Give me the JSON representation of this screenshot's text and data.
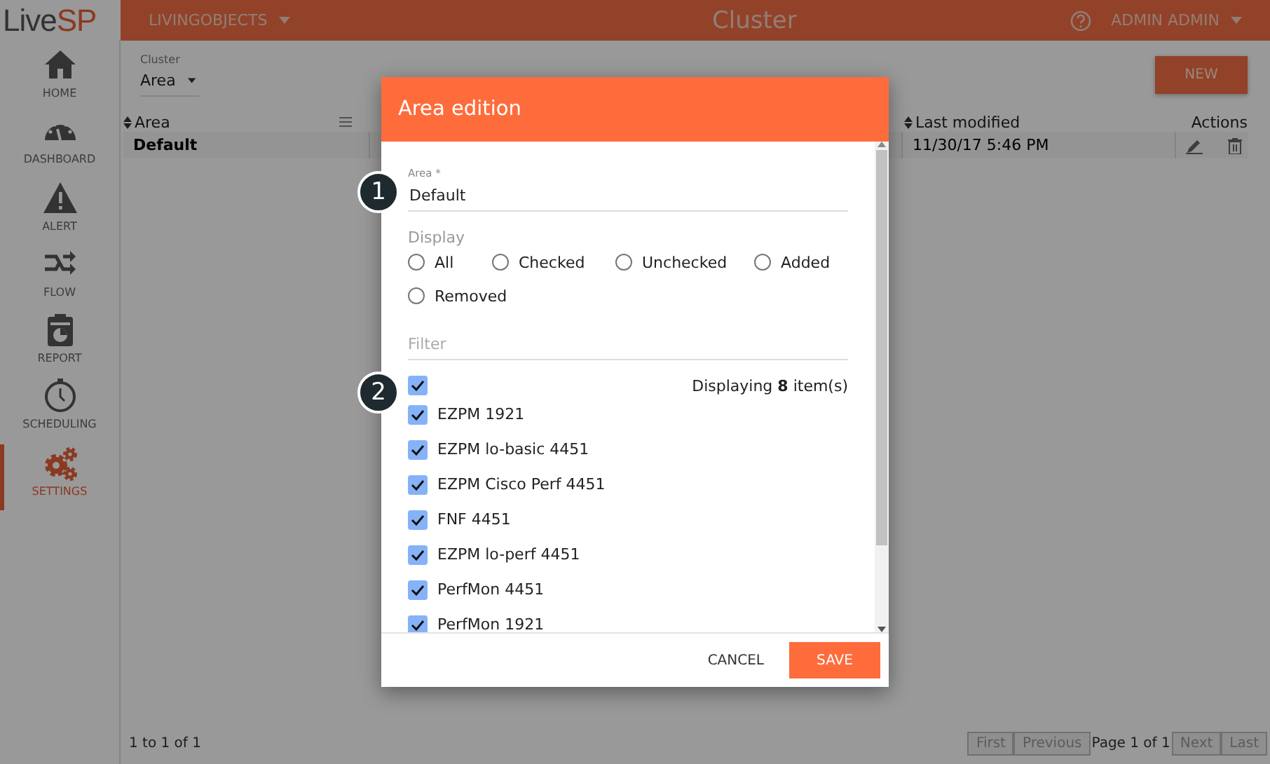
{
  "header": {
    "logo": [
      "Live",
      "SP"
    ],
    "org": "LIVINGOBJECTS",
    "title": "Cluster",
    "user": "ADMIN ADMIN"
  },
  "sidebar": {
    "items": [
      {
        "kind": "home",
        "label": "HOME",
        "selected": false
      },
      {
        "kind": "dashboard",
        "label": "DASHBOARD",
        "selected": false
      },
      {
        "kind": "alert",
        "label": "ALERT",
        "selected": false
      },
      {
        "kind": "flow",
        "label": "FLOW",
        "selected": false
      },
      {
        "kind": "report",
        "label": "REPORT",
        "selected": false
      },
      {
        "kind": "scheduling",
        "label": "SCHEDULING",
        "selected": false
      },
      {
        "kind": "settings",
        "label": "SETTINGS",
        "selected": true
      }
    ]
  },
  "toolbar": {
    "cluster_label": "Cluster",
    "cluster_value": "Area",
    "new_button": "NEW"
  },
  "table": {
    "columns": [
      "Area",
      "Last modified",
      "Actions"
    ],
    "rows": [
      {
        "area": "Default",
        "last_modified": "11/30/17 5:46 PM"
      }
    ]
  },
  "footer": {
    "count": "1 to 1 of 1",
    "pager": [
      {
        "label": "First",
        "disabled": true
      },
      {
        "label": "Previous",
        "disabled": true
      }
    ],
    "page": "Page 1 of 1",
    "pager_after": [
      {
        "label": "Next",
        "disabled": true
      },
      {
        "label": "Last",
        "disabled": true
      }
    ]
  },
  "dialog": {
    "title": "Area edition",
    "area_label": "Area *",
    "area_value": "Default",
    "display_label": "Display",
    "options": [
      {
        "label": "All",
        "selected": false
      },
      {
        "label": "Checked",
        "selected": false
      },
      {
        "label": "Unchecked",
        "selected": false
      },
      {
        "label": "Added",
        "selected": false
      },
      {
        "label": "Removed",
        "selected": false
      }
    ],
    "filter_placeholder": "Filter",
    "select_all": {
      "checked": true
    },
    "count": "Displaying **8** item(s)",
    "items": [
      {
        "label": "EZPM 1921",
        "checked": true
      },
      {
        "label": "EZPM lo-basic 4451",
        "checked": true
      },
      {
        "label": "EZPM Cisco Perf 4451",
        "checked": true
      },
      {
        "label": "FNF 4451",
        "checked": true
      },
      {
        "label": "EZPM lo-perf 4451",
        "checked": true
      },
      {
        "label": "PerfMon 4451",
        "checked": true
      },
      {
        "label": "PerfMon 1921",
        "checked": true
      }
    ],
    "cancel": "CANCEL",
    "save": "SAVE"
  },
  "callouts": [
    "1",
    "2"
  ]
}
